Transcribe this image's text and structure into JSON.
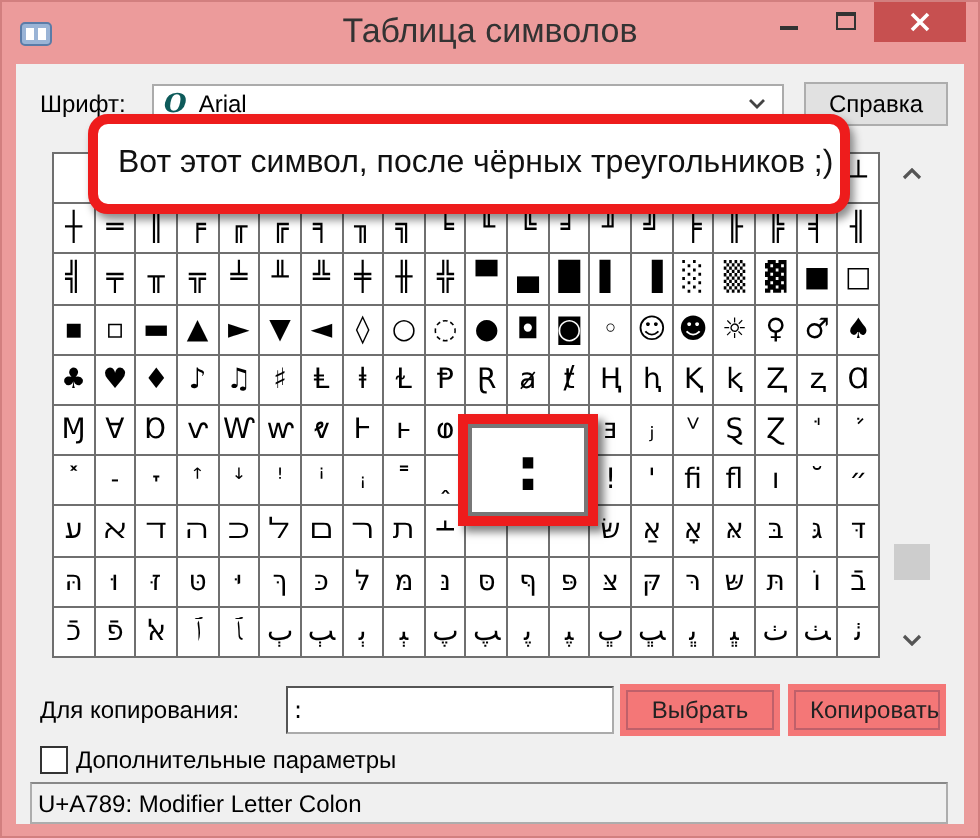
{
  "window": {
    "title": "Таблица символов"
  },
  "font": {
    "label": "Шрифт:",
    "icon": "O",
    "value": "Arial"
  },
  "help_button": {
    "label": "Справка",
    "highlighted": false
  },
  "callout": {
    "text": "Вот этот символ, после чёрных треугольников ;)"
  },
  "grid": {
    "rows": [
      [
        null,
        null,
        null,
        null,
        null,
        null,
        null,
        null,
        null,
        null,
        null,
        null,
        null,
        null,
        null,
        null,
        null,
        null,
        null,
        "┴"
      ],
      [
        "┼",
        "═",
        "║",
        "╒",
        "╓",
        "╔",
        "╕",
        "╖",
        "╗",
        "╘",
        "╙",
        "╚",
        "╛",
        "╜",
        "╝",
        "╞",
        "╟",
        "╠",
        "╡",
        "╢"
      ],
      [
        "╣",
        "╤",
        "╥",
        "╦",
        "╧",
        "╨",
        "╩",
        "╪",
        "╫",
        "╬",
        "▀",
        "▄",
        "█",
        "▌",
        "▐",
        "░",
        "▒",
        "▓",
        "■",
        "□"
      ],
      [
        "▪",
        "▫",
        "▬",
        "▲",
        "►",
        "▼",
        "◄",
        "◊",
        "○",
        "◌",
        "●",
        "◘",
        "◙",
        "◦",
        "☺",
        "☻",
        "☼",
        "♀",
        "♂",
        "♠"
      ],
      [
        "♣",
        "♥",
        "♦",
        "♪",
        "♫",
        "♯",
        "Ⱡ",
        "ⱡ",
        "Ɫ",
        "Ᵽ",
        "Ɽ",
        "ⱥ",
        "ⱦ",
        "Ⱨ",
        "ⱨ",
        "Ⱪ",
        "ⱪ",
        "Ⱬ",
        "ⱬ",
        "Ɑ"
      ],
      [
        "Ɱ",
        "Ɐ",
        "Ɒ",
        "ⱱ",
        "Ⱳ",
        "ⱳ",
        "ⱴ",
        "Ⱶ",
        "ⱶ",
        "ⱷ",
        null,
        null,
        null,
        "ⱻ",
        "ⱼ",
        "ⱽ",
        "Ȿ",
        "Ɀ",
        "ꜗ",
        "ꜘ"
      ],
      [
        "˟",
        "˗",
        "˕",
        "ꜛ",
        "ꜜ",
        "ꜝ",
        "ꜞ",
        "ꜟ",
        "˭",
        "ꞈ",
        null,
        null,
        null,
        "ǃ",
        "ꞌ",
        "ﬁ",
        "ﬂ",
        "ı",
        "˘",
        "״"
      ],
      [
        "ﬠ",
        "ﬡ",
        "ﬢ",
        "ﬣ",
        "ﬤ",
        "ﬥ",
        "ﬦ",
        "ﬧ",
        "ﬨ",
        "﬩",
        null,
        null,
        null,
        "שּׂ",
        "אַ",
        "אָ",
        "אּ",
        "בּ",
        "גּ",
        "דּ"
      ],
      [
        "הּ",
        "וּ",
        "זּ",
        "טּ",
        "יּ",
        "ךּ",
        "כּ",
        "לּ",
        "מּ",
        "נּ",
        "סּ",
        "ףּ",
        "פּ",
        "צּ",
        "קּ",
        "רּ",
        "שּ",
        "תּ",
        "וֹ",
        "בֿ"
      ],
      [
        "כֿ",
        "פֿ",
        "ﭏ",
        "ﭐ",
        "ﭑ",
        "ﭒ",
        "ﭓ",
        "ﭔ",
        "ﭕ",
        "ﭖ",
        "ﭗ",
        "ﭘ",
        "ﭙ",
        "ﭚ",
        "ﭛ",
        "ﭜ",
        "ﭝ",
        "ﭞ",
        "ﭟ",
        "ﭠ"
      ]
    ]
  },
  "preview": {
    "char": "꞉"
  },
  "copy": {
    "label": "Для копирования:",
    "value": "꞉"
  },
  "buttons": [
    {
      "label": "Выбрать",
      "highlighted": true
    },
    {
      "label": "Копировать",
      "highlighted": true
    }
  ],
  "advanced": {
    "label": "Дополнительные параметры",
    "checked": false
  },
  "status_bar": "U+A789: Modifier Letter Colon"
}
